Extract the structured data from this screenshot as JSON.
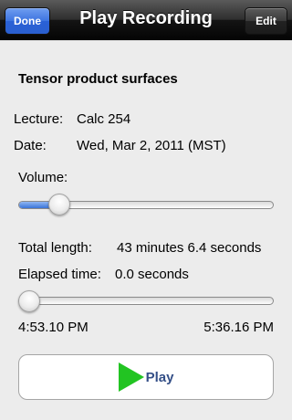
{
  "navbar": {
    "title": "Play Recording",
    "done_label": "Done",
    "edit_label": "Edit"
  },
  "recording": {
    "title": "Tensor product surfaces",
    "lecture_label": "Lecture:",
    "lecture_value": "Calc 254",
    "date_label": "Date:",
    "date_value": "Wed, Mar 2, 2011 (MST)"
  },
  "volume": {
    "label": "Volume:",
    "level": 0.13
  },
  "playback": {
    "total_label": "Total length:",
    "total_value": "43 minutes 6.4 seconds",
    "elapsed_label": "Elapsed time:",
    "elapsed_value": "0.0 seconds",
    "progress": 0.0,
    "start_time": "4:53.10 PM",
    "end_time": "5:36.16 PM"
  },
  "play_button": {
    "label": "Play",
    "icon": "play-icon",
    "icon_color": "#22c422"
  },
  "colors": {
    "done_button": "#3d74e0",
    "background": "#ececec",
    "play_label": "#344f87"
  }
}
